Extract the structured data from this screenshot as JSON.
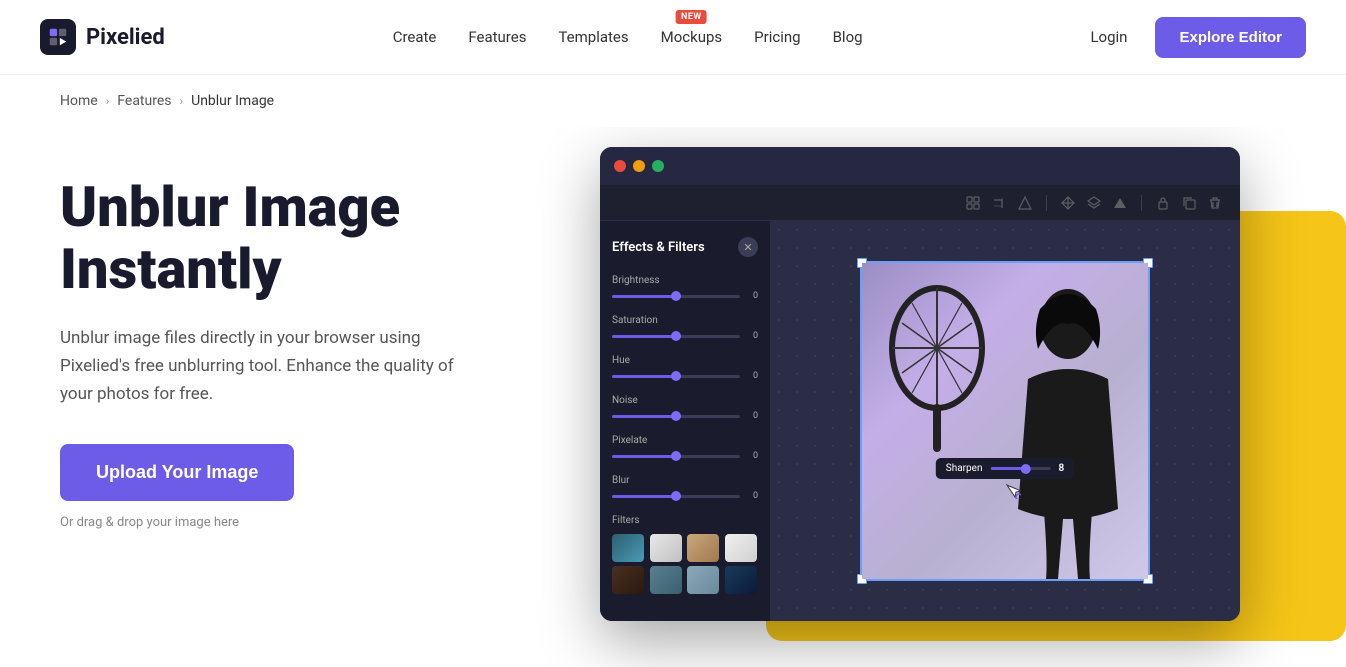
{
  "header": {
    "logo_text": "Pixelied",
    "nav": {
      "create": "Create",
      "features": "Features",
      "templates": "Templates",
      "mockups": "Mockups",
      "mockups_badge": "NEW",
      "pricing": "Pricing",
      "blog": "Blog",
      "login": "Login"
    },
    "cta": "Explore Editor"
  },
  "breadcrumb": {
    "home": "Home",
    "features": "Features",
    "current": "Unblur Image"
  },
  "hero": {
    "title_line1": "Unblur Image",
    "title_line2": "Instantly",
    "description": "Unblur image files directly in your browser using Pixelied's free unblurring tool. Enhance the quality of your photos for free.",
    "upload_btn": "Upload Your Image",
    "drag_hint": "Or drag & drop your image here"
  },
  "editor": {
    "panel_title": "Effects & Filters",
    "sliders": [
      {
        "label": "Brightness",
        "value": "0",
        "fill_pct": 50
      },
      {
        "label": "Saturation",
        "value": "0",
        "fill_pct": 50
      },
      {
        "label": "Hue",
        "value": "0",
        "fill_pct": 50
      },
      {
        "label": "Noise",
        "value": "0",
        "fill_pct": 50
      },
      {
        "label": "Pixelate",
        "value": "0",
        "fill_pct": 50
      },
      {
        "label": "Blur",
        "value": "0",
        "fill_pct": 50
      }
    ],
    "filters_label": "Filters",
    "sharpen_label": "Sharpen",
    "sharpen_value": "8"
  }
}
